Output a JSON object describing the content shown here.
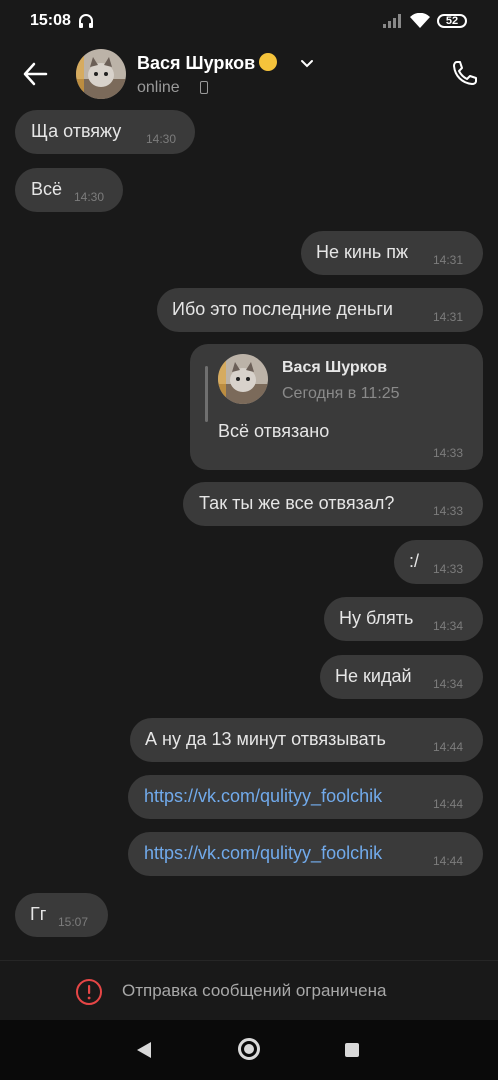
{
  "status_bar": {
    "time": "15:08",
    "battery": "52"
  },
  "header": {
    "contact_name": "Вася Шурков",
    "status": "online"
  },
  "messages": [
    {
      "text": "Ща отвяжу",
      "time": "14:30",
      "side": "in"
    },
    {
      "text": "Всё",
      "time": "14:30",
      "side": "in"
    },
    {
      "text": "Не кинь пж",
      "time": "14:31",
      "side": "out"
    },
    {
      "text": "Ибо это последние деньги",
      "time": "14:31",
      "side": "out"
    },
    {
      "text": "Так ты же все отвязал?",
      "time": "14:33",
      "side": "out"
    },
    {
      "text": ":/",
      "time": "14:33",
      "side": "out"
    },
    {
      "text": "Ну блять",
      "time": "14:34",
      "side": "out"
    },
    {
      "text": "Не кидай",
      "time": "14:34",
      "side": "out"
    },
    {
      "text": "А ну да 13 минут отвязывать",
      "time": "14:44",
      "side": "out"
    },
    {
      "text": "https://vk.com/qulityy_foolchik",
      "time": "14:44",
      "side": "out",
      "link": true
    },
    {
      "text": "https://vk.com/qulityy_foolchik",
      "time": "14:44",
      "side": "out",
      "link": true
    },
    {
      "text": "Гг",
      "time": "15:07",
      "side": "in"
    }
  ],
  "forwarded": {
    "author": "Вася Шурков",
    "date": "Сегодня в 11:25",
    "text": "Всё отвязано",
    "time": "14:33"
  },
  "restriction": {
    "text": "Отправка сообщений ограничена",
    "color": "#e64646"
  },
  "colors": {
    "background": "#191919",
    "bubble": "#3a3a3a",
    "link": "#71aaeb"
  }
}
